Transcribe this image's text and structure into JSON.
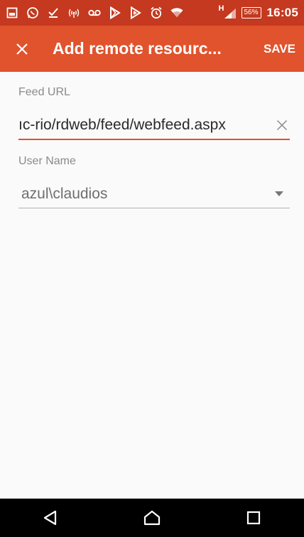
{
  "status_bar": {
    "icons": [
      "gallery-icon",
      "whatsapp-icon",
      "download-icon",
      "hotspot-icon",
      "voicemail-icon",
      "play-store-icon",
      "play-icon",
      "alarm-icon",
      "wifi-icon",
      "signal-icon"
    ],
    "network_type": "H",
    "battery": "56%",
    "time": "16:05",
    "background_color": "#c4391f"
  },
  "app_bar": {
    "title": "Add remote resourc...",
    "save_label": "SAVE",
    "background_color": "#e0532d"
  },
  "form": {
    "feed_url": {
      "label": "Feed URL",
      "value": "ıc-rio/rdweb/feed/webfeed.aspx"
    },
    "user_name": {
      "label": "User Name",
      "value": "azul\\claudios"
    }
  },
  "nav_bar": {
    "buttons": [
      "back-icon",
      "home-icon",
      "recents-icon"
    ]
  }
}
